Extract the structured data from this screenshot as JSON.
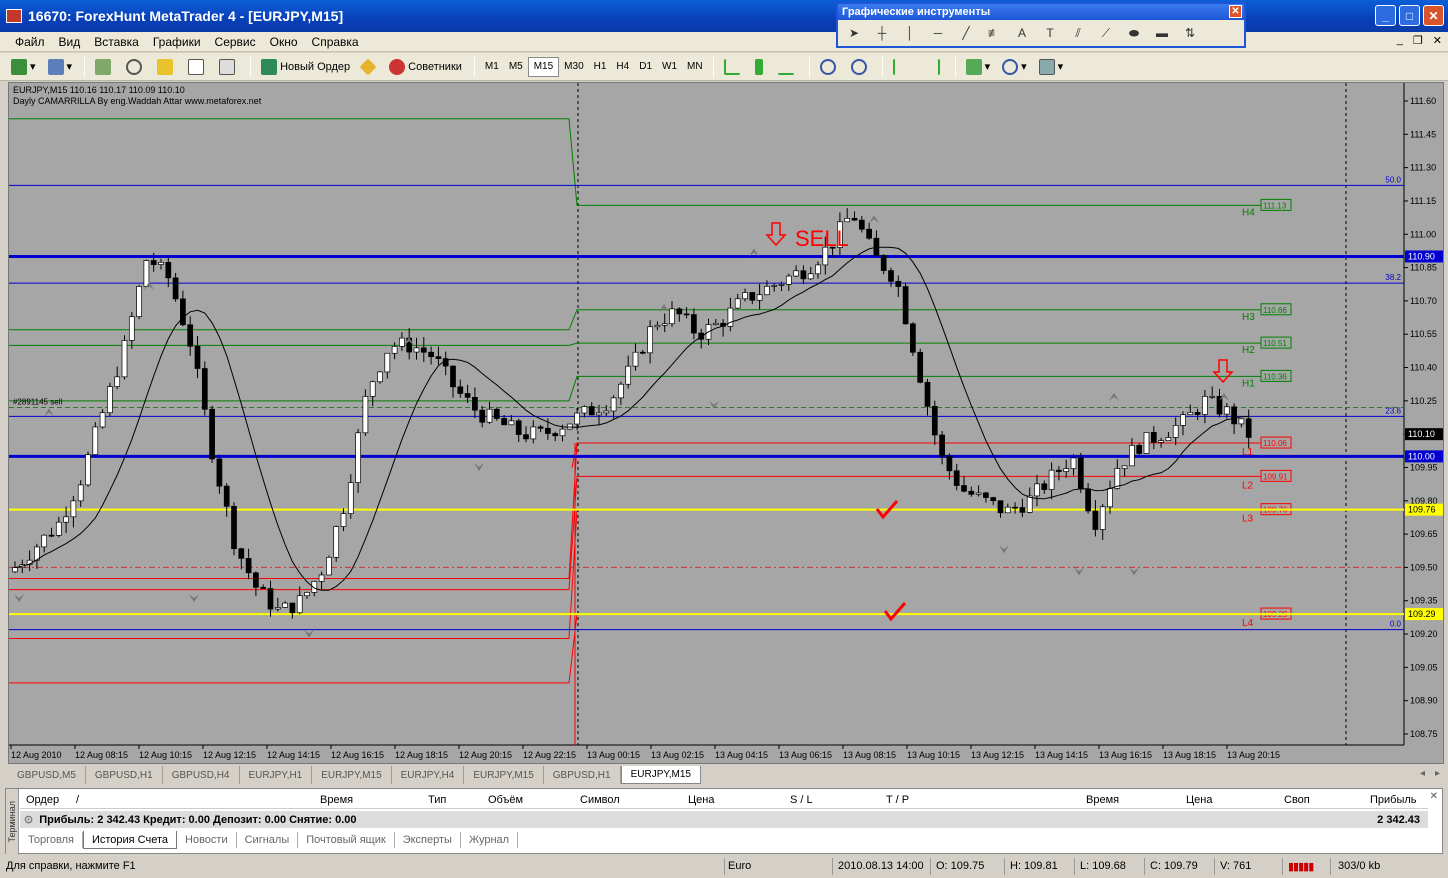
{
  "window": {
    "title": "16670: ForexHunt MetaTrader 4 - [EURJPY,M15]"
  },
  "menu": [
    "Файл",
    "Вид",
    "Вставка",
    "Графики",
    "Сервис",
    "Окно",
    "Справка"
  ],
  "toolbar": {
    "new_order": "Новый Ордер",
    "advisors": "Советники",
    "timeframes": [
      "M1",
      "M5",
      "M15",
      "M30",
      "H1",
      "H4",
      "D1",
      "W1",
      "MN"
    ],
    "active_tf": "M15"
  },
  "draw_tools": {
    "title": "Графические инструменты",
    "tools": [
      "cursor-icon",
      "crosshair-icon",
      "vertical-line-icon",
      "horizontal-line-icon",
      "trendline-icon",
      "fibo-channel-icon",
      "text-icon",
      "text-label-icon",
      "fibo-icon",
      "fibo-fan-icon",
      "ellipse-icon",
      "rectangle-icon",
      "arrows-icon"
    ],
    "labels": {
      "text": "A",
      "label": "T"
    }
  },
  "chart": {
    "info_line1": "EURJPY,M15  110.16 110.17 110.09 110.10",
    "info_line2": "Dayly CAMARRILLA By eng.Waddah Attar www.metaforex.net",
    "order_label": "#2891145 sell",
    "sell_text": "SELL",
    "price_axis": [
      "111.60",
      "111.45",
      "111.30",
      "111.15",
      "111.00",
      "110.85",
      "110.70",
      "110.55",
      "110.40",
      "110.25",
      "110.10",
      "109.95",
      "109.80",
      "109.65",
      "109.50",
      "109.35",
      "109.20",
      "109.05",
      "108.90",
      "108.75"
    ],
    "current_price": "110.10",
    "blue_level_top": "110.90",
    "blue_level_bottom": "110.00",
    "yellow_level_1": "109.76",
    "yellow_level_2": "109.29",
    "fib_labels": {
      "f50": "50.0",
      "f382": "38.2",
      "f236": "23.6",
      "f0": "0.0"
    },
    "camarilla": {
      "H4": "111.13",
      "H3": "110.66",
      "H2": "110.51",
      "H1": "110.36",
      "L1": "110.06",
      "L2": "109.91",
      "L3": "109.76",
      "L4": "109.29"
    },
    "time_axis": [
      "12 Aug 2010",
      "12 Aug 08:15",
      "12 Aug 10:15",
      "12 Aug 12:15",
      "12 Aug 14:15",
      "12 Aug 16:15",
      "12 Aug 18:15",
      "12 Aug 20:15",
      "12 Aug 22:15",
      "13 Aug 00:15",
      "13 Aug 02:15",
      "13 Aug 04:15",
      "13 Aug 06:15",
      "13 Aug 08:15",
      "13 Aug 10:15",
      "13 Aug 12:15",
      "13 Aug 14:15",
      "13 Aug 16:15",
      "13 Aug 18:15",
      "13 Aug 20:15"
    ],
    "colors": {
      "background": "#a6a6a6",
      "blue": "#0000d0",
      "green": "#008000",
      "red": "#ff0000",
      "yellow": "#ffff00"
    }
  },
  "chart_tabs": [
    "GBPUSD,M5",
    "GBPUSD,H1",
    "GBPUSD,H4",
    "EURJPY,H1",
    "EURJPY,M15",
    "EURJPY,H4",
    "EURJPY,M15",
    "GBPUSD,H1",
    "EURJPY,M15"
  ],
  "active_chart_tab": 8,
  "terminal": {
    "side_label": "Терминал",
    "columns": [
      "Ордер",
      "/",
      "Время",
      "Тип",
      "Объём",
      "Символ",
      "Цена",
      "S / L",
      "T / P",
      "Время",
      "Цена",
      "Своп",
      "Прибыль"
    ],
    "summary": "Прибыль: 2 342.43  Кредит: 0.00  Депозит: 0.00  Снятие: 0.00",
    "summary_profit": "2 342.43",
    "tabs": [
      "Торговля",
      "История Счета",
      "Новости",
      "Сигналы",
      "Почтовый ящик",
      "Эксперты",
      "Журнал"
    ],
    "active_tab": 1
  },
  "status": {
    "help": "Для справки, нажмите F1",
    "profile": "Euro",
    "datetime": "2010.08.13 14:00",
    "open": "O: 109.75",
    "high": "H: 109.81",
    "low": "L: 109.68",
    "close": "C: 109.79",
    "volume": "V: 761",
    "traffic": "303/0 kb"
  }
}
